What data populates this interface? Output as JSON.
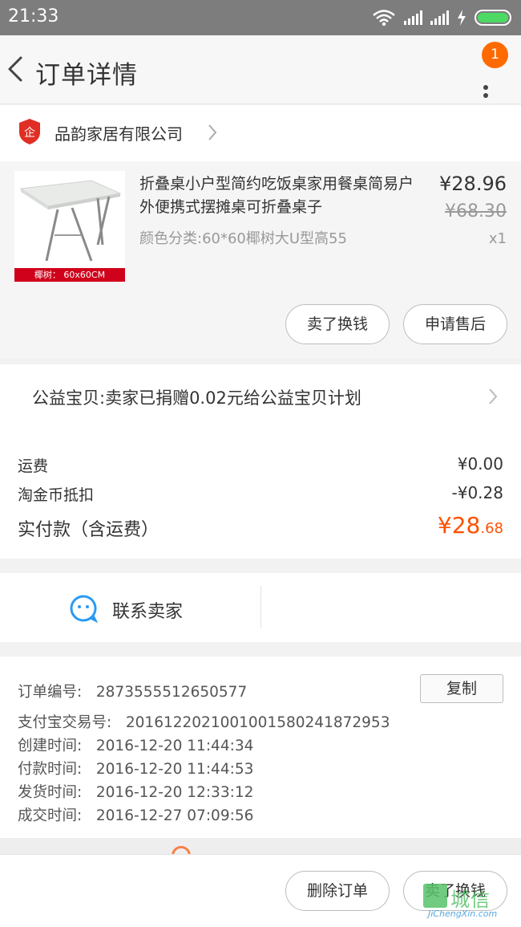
{
  "status_bar": {
    "time": "21:33"
  },
  "navbar": {
    "title": "订单详情",
    "badge_count": "1"
  },
  "shop": {
    "name": "品韵家居有限公司",
    "logo_text": "企"
  },
  "product": {
    "title": "折叠桌小户型简约吃饭桌家用餐桌简易户外便携式摆摊桌可折叠桌子",
    "spec": "颜色分类:60*60椰树大U型高55",
    "price": "¥28.96",
    "original_price": "¥68.30",
    "quantity": "x1",
    "image_caption": "椰树： 60x60CM",
    "actions": [
      "卖了换钱",
      "申请售后"
    ]
  },
  "charity": {
    "text": "公益宝贝:卖家已捐赠0.02元给公益宝贝计划"
  },
  "fees": {
    "shipping_label": "运费",
    "shipping_value": "¥0.00",
    "coin_label": "淘金币抵扣",
    "coin_value": "-¥0.28",
    "paid_label": "实付款（含运费）",
    "paid_main": "¥28",
    "paid_decimal": ".68"
  },
  "contact": {
    "label": "联系卖家"
  },
  "order_info": {
    "copy_label": "复制",
    "rows": [
      {
        "label": "订单编号:",
        "value": "2873555512650577"
      },
      {
        "label": "支付宝交易号:",
        "value": "2016122021001001580241872953"
      },
      {
        "label": "创建时间:",
        "value": "2016-12-20 11:44:34"
      },
      {
        "label": "付款时间:",
        "value": "2016-12-20 11:44:53"
      },
      {
        "label": "发货时间:",
        "value": "2016-12-20 12:33:12"
      },
      {
        "label": "成交时间:",
        "value": "2016-12-27 07:09:56"
      }
    ]
  },
  "bottom_bar": {
    "delete_label": "删除订单",
    "sell_label": "卖了换钱"
  },
  "watermark": {
    "cn": "城信",
    "en": "JiChengXin.com"
  },
  "colors": {
    "accent": "#ff5000",
    "status_bar": "#7d7d7d",
    "badge": "#ff6a00"
  }
}
